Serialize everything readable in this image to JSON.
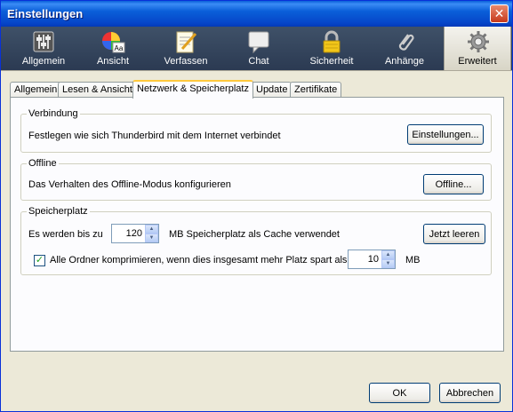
{
  "window": {
    "title": "Einstellungen"
  },
  "toolbar": {
    "panes": [
      {
        "label": "Allgemein",
        "icon": "sliders-icon"
      },
      {
        "label": "Ansicht",
        "icon": "color-wheel-icon"
      },
      {
        "label": "Verfassen",
        "icon": "notepad-pen-icon"
      },
      {
        "label": "Chat",
        "icon": "speech-bubble-icon"
      },
      {
        "label": "Sicherheit",
        "icon": "padlock-icon"
      },
      {
        "label": "Anhänge",
        "icon": "paperclip-icon"
      },
      {
        "label": "Erweitert",
        "icon": "gear-icon"
      }
    ],
    "selected": "Erweitert"
  },
  "tabs": [
    {
      "label": "Allgemein"
    },
    {
      "label": "Lesen & Ansicht"
    },
    {
      "label": "Netzwerk & Speicherplatz"
    },
    {
      "label": "Update"
    },
    {
      "label": "Zertifikate"
    }
  ],
  "active_tab": "Netzwerk & Speicherplatz",
  "connection": {
    "legend": "Verbindung",
    "description": "Festlegen wie sich Thunderbird mit dem Internet verbindet",
    "button": "Einstellungen..."
  },
  "offline": {
    "legend": "Offline",
    "description": "Das Verhalten des Offline-Modus konfigurieren",
    "button": "Offline..."
  },
  "storage": {
    "legend": "Speicherplatz",
    "cache_prefix": "Es werden bis zu",
    "cache_value": "120",
    "cache_suffix": "MB Speicherplatz als Cache verwendet",
    "clear_button": "Jetzt leeren",
    "compact_checked": true,
    "compact_label": "Alle Ordner komprimieren, wenn dies insgesamt mehr Platz spart als",
    "compact_value": "10",
    "compact_unit": "MB"
  },
  "footer": {
    "ok": "OK",
    "cancel": "Abbrechen"
  }
}
